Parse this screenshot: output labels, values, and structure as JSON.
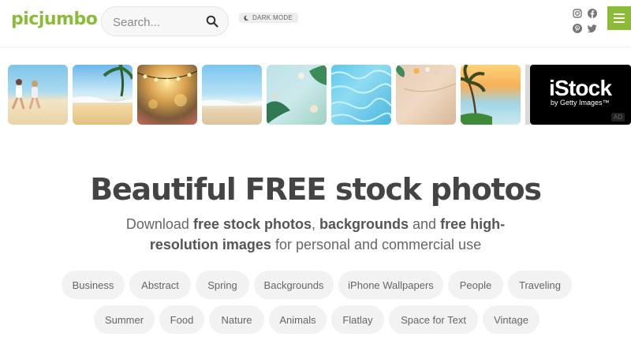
{
  "header": {
    "logo": "picjumbo",
    "search_placeholder": "Search...",
    "dark_mode_label": "DARK MODE",
    "social": [
      "instagram",
      "facebook",
      "pinterest",
      "twitter"
    ]
  },
  "thumbnails": [
    "beach-running",
    "tropical-beach",
    "string-lights",
    "sea-shore",
    "palm-leaves-flatlay",
    "pool-water",
    "sand-shells",
    "palm-sunset"
  ],
  "ad": {
    "brand": "iStock",
    "tagline": "by Getty Images™",
    "badge": "AD"
  },
  "hero": {
    "title": "Beautiful FREE stock photos",
    "sub_1": "Download ",
    "sub_b1": "free stock photos",
    "sub_2": ", ",
    "sub_b2": "backgrounds",
    "sub_3": " and ",
    "sub_b3": "free high-resolution images",
    "sub_4": " for personal and commercial use"
  },
  "tags": {
    "row1": [
      "Business",
      "Abstract",
      "Spring",
      "Backgrounds",
      "iPhone Wallpapers",
      "People",
      "Traveling"
    ],
    "row2": [
      "Summer",
      "Food",
      "Nature",
      "Animals",
      "Flatlay",
      "Space for Text",
      "Vintage"
    ]
  },
  "colors": {
    "brand": "#8cbb37"
  }
}
